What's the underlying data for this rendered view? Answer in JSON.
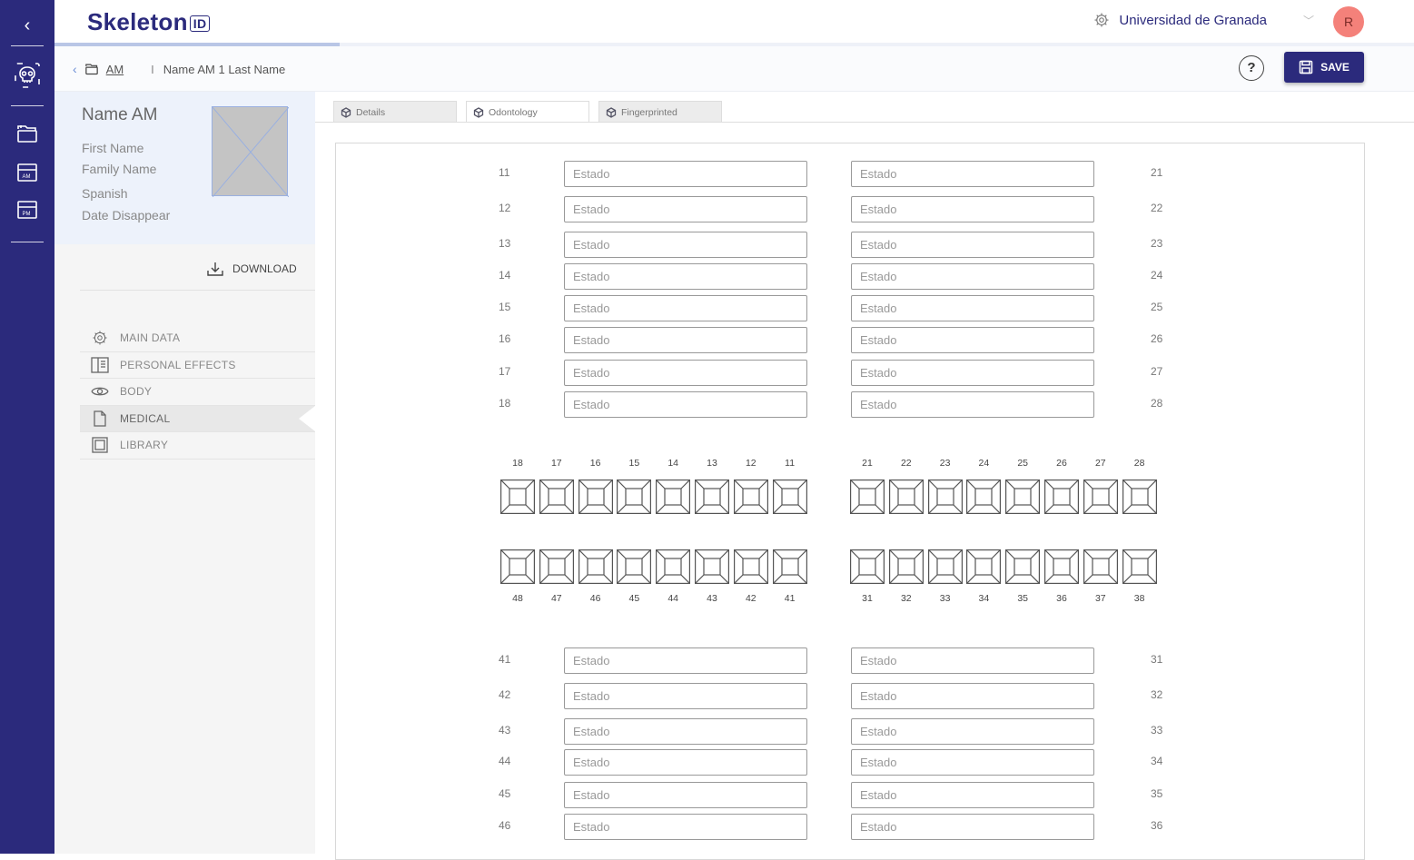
{
  "brand": {
    "name": "Skeleton",
    "suffix": "ID",
    "color": "#2b2a7c"
  },
  "organization": "Universidad de Granada",
  "user_initial": "R",
  "progress_fraction": 0.21,
  "breadcrumb": {
    "section": "AM",
    "record": "Name AM 1 Last Name"
  },
  "save_label": "SAVE",
  "help_label": "?",
  "profile": {
    "name": "Name AM",
    "first_name": "First Name",
    "family_name": "Family Name",
    "language": "Spanish",
    "date_disappear": "Date Disappear"
  },
  "download_label": "DOWNLOAD",
  "menu": [
    {
      "label": "MAIN DATA",
      "icon": "gear-icon"
    },
    {
      "label": "PERSONAL EFFECTS",
      "icon": "book-icon"
    },
    {
      "label": "BODY",
      "icon": "eye-icon"
    },
    {
      "label": "MEDICAL",
      "icon": "document-icon",
      "active": true
    },
    {
      "label": "LIBRARY",
      "icon": "frame-icon"
    }
  ],
  "tabs": [
    {
      "label": "Details"
    },
    {
      "label": "Odontology",
      "active": true
    },
    {
      "label": "Fingerprinted"
    }
  ],
  "placeholder": "Estado",
  "upper_rows": [
    {
      "left": "11",
      "right": "21"
    },
    {
      "left": "12",
      "right": "22"
    },
    {
      "left": "13",
      "right": "23"
    },
    {
      "left": "14",
      "right": "24"
    },
    {
      "left": "15",
      "right": "25"
    },
    {
      "left": "16",
      "right": "26"
    },
    {
      "left": "17",
      "right": "27"
    },
    {
      "left": "18",
      "right": "28"
    }
  ],
  "chart_upper_left": [
    "18",
    "17",
    "16",
    "15",
    "14",
    "13",
    "12",
    "11"
  ],
  "chart_upper_right": [
    "21",
    "22",
    "23",
    "24",
    "25",
    "26",
    "27",
    "28"
  ],
  "chart_lower_left": [
    "48",
    "47",
    "46",
    "45",
    "44",
    "43",
    "42",
    "41"
  ],
  "chart_lower_right": [
    "31",
    "32",
    "33",
    "34",
    "35",
    "36",
    "37",
    "38"
  ],
  "lower_rows": [
    {
      "left": "41",
      "right": "31"
    },
    {
      "left": "42",
      "right": "32"
    },
    {
      "left": "43",
      "right": "33"
    },
    {
      "left": "44",
      "right": "34"
    },
    {
      "left": "45",
      "right": "35"
    },
    {
      "left": "46",
      "right": "36"
    }
  ]
}
